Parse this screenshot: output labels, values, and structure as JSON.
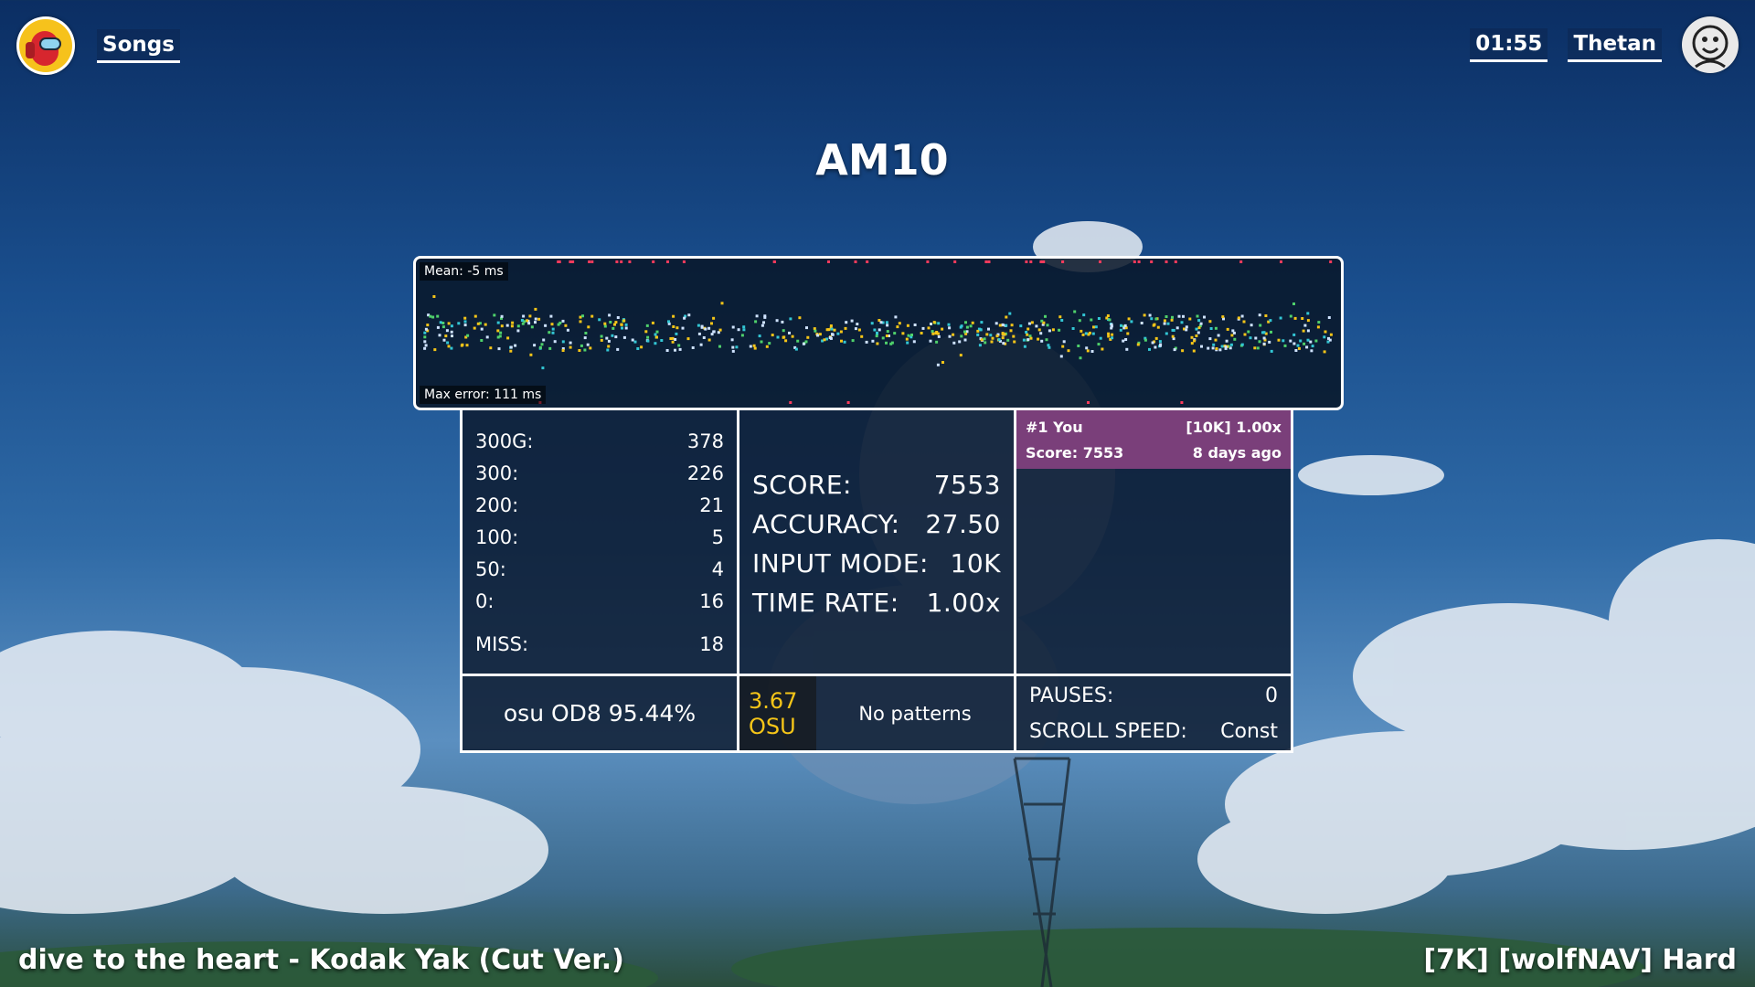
{
  "header": {
    "songs_label": "Songs",
    "clock": "01:55",
    "username": "Thetan"
  },
  "title": "AM10",
  "graph": {
    "mean_label": "Mean: -5 ms",
    "max_error_label": "Max error: 111 ms"
  },
  "judgements": [
    {
      "label": "300G:",
      "value": "378"
    },
    {
      "label": "300:",
      "value": "226"
    },
    {
      "label": "200:",
      "value": "21"
    },
    {
      "label": "100:",
      "value": "5"
    },
    {
      "label": "50:",
      "value": "4"
    },
    {
      "label": "0:",
      "value": "16"
    }
  ],
  "miss": {
    "label": "MISS:",
    "value": "18"
  },
  "stats": [
    {
      "label": "SCORE:",
      "value": "7553"
    },
    {
      "label": "ACCURACY:",
      "value": "27.50"
    },
    {
      "label": "INPUT MODE:",
      "value": "10K"
    },
    {
      "label": "TIME RATE:",
      "value": "1.00x"
    }
  ],
  "leaderboard": {
    "rank_name": "#1 You",
    "mode_rate": "[10K] 1.00x",
    "score": "Score: 7553",
    "time_ago": "8 days ago"
  },
  "osu_accuracy": "osu OD8 95.44%",
  "difficulty": {
    "value": "3.67",
    "system": "OSU"
  },
  "patterns": "No patterns",
  "extra": [
    {
      "label": "PAUSES:",
      "value": "0"
    },
    {
      "label": "SCROLL SPEED:",
      "value": "Const"
    }
  ],
  "footer": {
    "song": "dive to the heart - Kodak Yak (Cut Ver.)",
    "chart": "[7K] [wolfNAV] Hard"
  },
  "colors": {
    "dot_gold": "#f5c518",
    "dot_lightblue": "#cfe3ff",
    "dot_cyan": "#33c6d4",
    "dot_green": "#4fd16b",
    "dot_miss": "#ff3b5c",
    "difficulty": "#f5c518",
    "leaderboard_bg": "#7a3f7a"
  }
}
